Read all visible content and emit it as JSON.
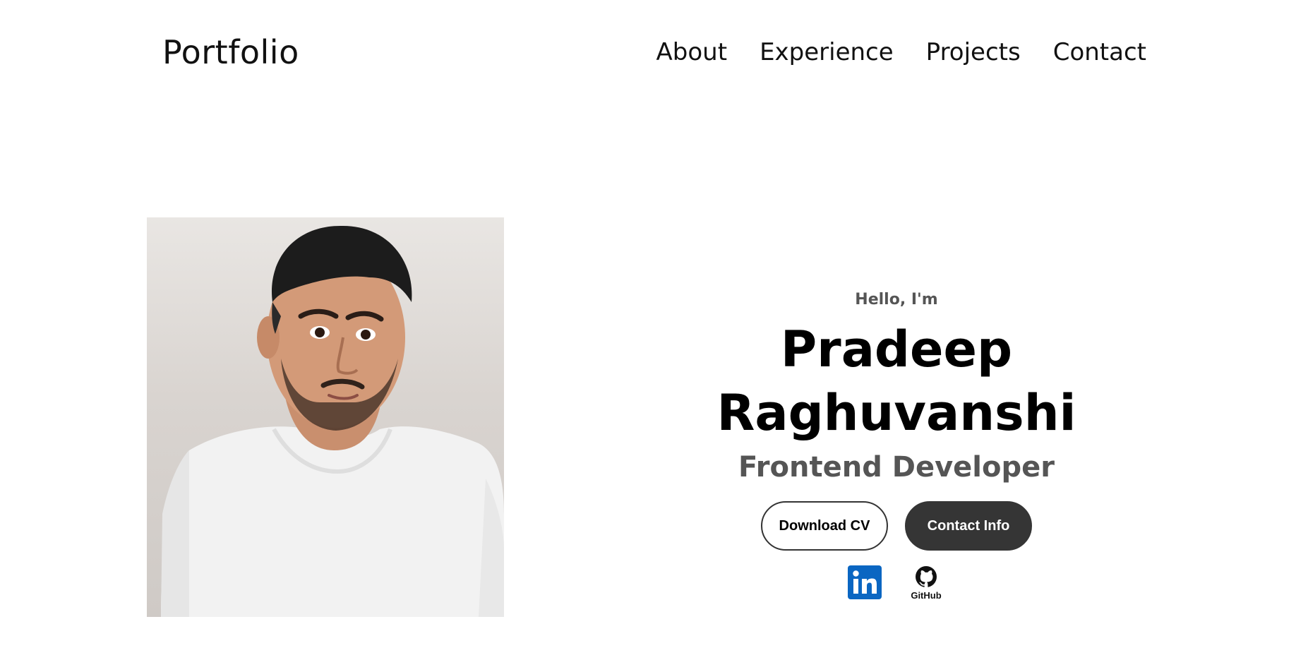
{
  "header": {
    "logo": "Portfolio",
    "nav": [
      {
        "label": "About"
      },
      {
        "label": "Experience"
      },
      {
        "label": "Projects"
      },
      {
        "label": "Contact"
      }
    ]
  },
  "hero": {
    "greeting": "Hello, I'm",
    "name": "Pradeep Raghuvanshi",
    "role": "Frontend Developer",
    "buttons": {
      "download_cv": "Download CV",
      "contact_info": "Contact Info"
    },
    "socials": {
      "linkedin_icon": "linkedin-icon",
      "github_icon": "github-icon",
      "github_label": "GitHub"
    }
  },
  "colors": {
    "accent_dark": "#353535",
    "subtext": "#555555",
    "linkedin_blue": "#0a66c2"
  }
}
